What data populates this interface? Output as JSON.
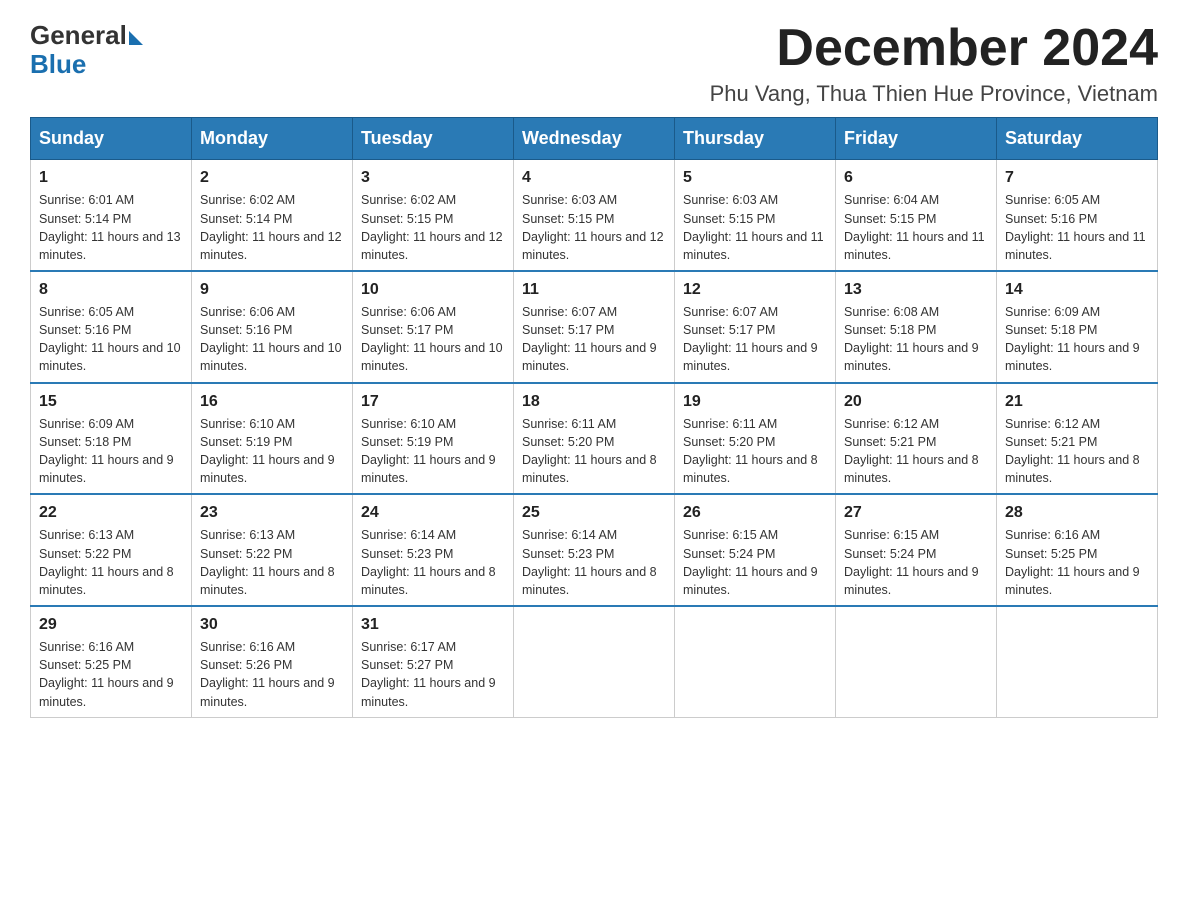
{
  "header": {
    "logo_general": "General",
    "logo_blue": "Blue",
    "title": "December 2024",
    "subtitle": "Phu Vang, Thua Thien Hue Province, Vietnam"
  },
  "days_of_week": [
    "Sunday",
    "Monday",
    "Tuesday",
    "Wednesday",
    "Thursday",
    "Friday",
    "Saturday"
  ],
  "weeks": [
    [
      {
        "day": "1",
        "sunrise": "6:01 AM",
        "sunset": "5:14 PM",
        "daylight": "11 hours and 13 minutes."
      },
      {
        "day": "2",
        "sunrise": "6:02 AM",
        "sunset": "5:14 PM",
        "daylight": "11 hours and 12 minutes."
      },
      {
        "day": "3",
        "sunrise": "6:02 AM",
        "sunset": "5:15 PM",
        "daylight": "11 hours and 12 minutes."
      },
      {
        "day": "4",
        "sunrise": "6:03 AM",
        "sunset": "5:15 PM",
        "daylight": "11 hours and 12 minutes."
      },
      {
        "day": "5",
        "sunrise": "6:03 AM",
        "sunset": "5:15 PM",
        "daylight": "11 hours and 11 minutes."
      },
      {
        "day": "6",
        "sunrise": "6:04 AM",
        "sunset": "5:15 PM",
        "daylight": "11 hours and 11 minutes."
      },
      {
        "day": "7",
        "sunrise": "6:05 AM",
        "sunset": "5:16 PM",
        "daylight": "11 hours and 11 minutes."
      }
    ],
    [
      {
        "day": "8",
        "sunrise": "6:05 AM",
        "sunset": "5:16 PM",
        "daylight": "11 hours and 10 minutes."
      },
      {
        "day": "9",
        "sunrise": "6:06 AM",
        "sunset": "5:16 PM",
        "daylight": "11 hours and 10 minutes."
      },
      {
        "day": "10",
        "sunrise": "6:06 AM",
        "sunset": "5:17 PM",
        "daylight": "11 hours and 10 minutes."
      },
      {
        "day": "11",
        "sunrise": "6:07 AM",
        "sunset": "5:17 PM",
        "daylight": "11 hours and 9 minutes."
      },
      {
        "day": "12",
        "sunrise": "6:07 AM",
        "sunset": "5:17 PM",
        "daylight": "11 hours and 9 minutes."
      },
      {
        "day": "13",
        "sunrise": "6:08 AM",
        "sunset": "5:18 PM",
        "daylight": "11 hours and 9 minutes."
      },
      {
        "day": "14",
        "sunrise": "6:09 AM",
        "sunset": "5:18 PM",
        "daylight": "11 hours and 9 minutes."
      }
    ],
    [
      {
        "day": "15",
        "sunrise": "6:09 AM",
        "sunset": "5:18 PM",
        "daylight": "11 hours and 9 minutes."
      },
      {
        "day": "16",
        "sunrise": "6:10 AM",
        "sunset": "5:19 PM",
        "daylight": "11 hours and 9 minutes."
      },
      {
        "day": "17",
        "sunrise": "6:10 AM",
        "sunset": "5:19 PM",
        "daylight": "11 hours and 9 minutes."
      },
      {
        "day": "18",
        "sunrise": "6:11 AM",
        "sunset": "5:20 PM",
        "daylight": "11 hours and 8 minutes."
      },
      {
        "day": "19",
        "sunrise": "6:11 AM",
        "sunset": "5:20 PM",
        "daylight": "11 hours and 8 minutes."
      },
      {
        "day": "20",
        "sunrise": "6:12 AM",
        "sunset": "5:21 PM",
        "daylight": "11 hours and 8 minutes."
      },
      {
        "day": "21",
        "sunrise": "6:12 AM",
        "sunset": "5:21 PM",
        "daylight": "11 hours and 8 minutes."
      }
    ],
    [
      {
        "day": "22",
        "sunrise": "6:13 AM",
        "sunset": "5:22 PM",
        "daylight": "11 hours and 8 minutes."
      },
      {
        "day": "23",
        "sunrise": "6:13 AM",
        "sunset": "5:22 PM",
        "daylight": "11 hours and 8 minutes."
      },
      {
        "day": "24",
        "sunrise": "6:14 AM",
        "sunset": "5:23 PM",
        "daylight": "11 hours and 8 minutes."
      },
      {
        "day": "25",
        "sunrise": "6:14 AM",
        "sunset": "5:23 PM",
        "daylight": "11 hours and 8 minutes."
      },
      {
        "day": "26",
        "sunrise": "6:15 AM",
        "sunset": "5:24 PM",
        "daylight": "11 hours and 9 minutes."
      },
      {
        "day": "27",
        "sunrise": "6:15 AM",
        "sunset": "5:24 PM",
        "daylight": "11 hours and 9 minutes."
      },
      {
        "day": "28",
        "sunrise": "6:16 AM",
        "sunset": "5:25 PM",
        "daylight": "11 hours and 9 minutes."
      }
    ],
    [
      {
        "day": "29",
        "sunrise": "6:16 AM",
        "sunset": "5:25 PM",
        "daylight": "11 hours and 9 minutes."
      },
      {
        "day": "30",
        "sunrise": "6:16 AM",
        "sunset": "5:26 PM",
        "daylight": "11 hours and 9 minutes."
      },
      {
        "day": "31",
        "sunrise": "6:17 AM",
        "sunset": "5:27 PM",
        "daylight": "11 hours and 9 minutes."
      },
      null,
      null,
      null,
      null
    ]
  ]
}
